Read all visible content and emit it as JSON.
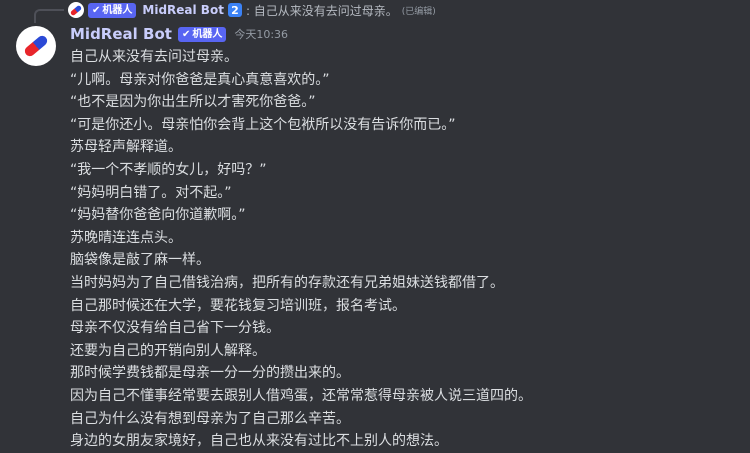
{
  "reply": {
    "bot_tag": "机器人",
    "username": "MidReal Bot",
    "keycap": "2",
    "text": ": 自己从来没有去问过母亲。",
    "edited": "(已编辑)"
  },
  "message": {
    "username": "MidReal Bot",
    "bot_tag": "机器人",
    "timestamp": "今天10:36",
    "lines": [
      "自己从来没有去问过母亲。",
      "“儿啊。母亲对你爸爸是真心真意喜欢的。”",
      "“也不是因为你出生所以才害死你爸爸。”",
      "“可是你还小。母亲怕你会背上这个包袱所以没有告诉你而已。”",
      "苏母轻声解释道。",
      "“我一个不孝顺的女儿，好吗？”",
      "“妈妈明白错了。对不起。”",
      "“妈妈替你爸爸向你道歉啊。”",
      "苏晚晴连连点头。",
      "脑袋像是敲了麻一样。",
      "当时妈妈为了自己借钱治病，把所有的存款还有兄弟姐妹送钱都借了。",
      "自己那时候还在大学，要花钱复习培训班，报名考试。",
      "母亲不仅没有给自己省下一分钱。",
      "还要为自己的开销向别人解释。",
      "那时候学费钱都是母亲一分一分的攒出来的。",
      "因为自己不懂事经常要去跟别人借鸡蛋，还常常惹得母亲被人说三道四的。",
      "自己为什么没有想到母亲为了自己那么辛苦。",
      "身边的女朋友家境好，自己也从来没有过比不上别人的想法。"
    ]
  },
  "colors": {
    "background": "#313338",
    "text": "#dbdee1",
    "username": "#c9cdfb",
    "bot_tag": "#5865f2",
    "muted": "#949ba4"
  }
}
